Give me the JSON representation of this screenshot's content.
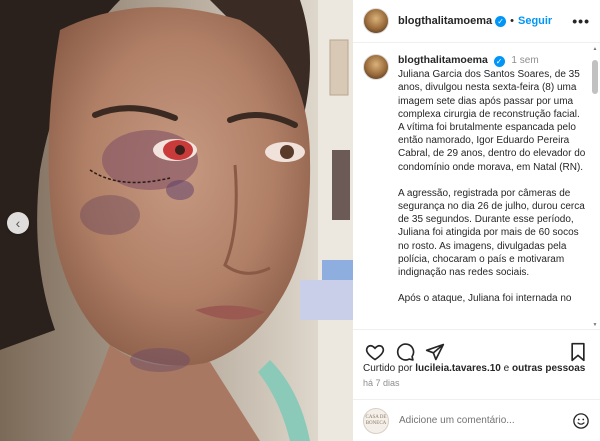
{
  "post": {
    "username": "blogthalitamoema",
    "follow_label": "Seguir",
    "more_label": "•••",
    "caption_time": "1 sem",
    "caption_paragraphs": [
      "Juliana Garcia dos Santos Soares, de 35 anos, divulgou nesta sexta-feira (8) uma imagem sete dias após passar por uma complexa cirurgia de reconstrução facial. A vítima foi brutalmente espancada pelo então namorado, Igor Eduardo Pereira Cabral, de 29 anos, dentro do elevador do condomínio onde morava, em Natal (RN).",
      "A agressão, registrada por câmeras de segurança no dia 26 de julho, durou cerca de 35 segundos. Durante esse período, Juliana foi atingida por mais de 60 socos no rosto. As imagens, divulgadas pela polícia, chocaram o país e motivaram indignação nas redes sociais.",
      "Após o ataque, Juliana foi internada no"
    ],
    "liked_by_prefix": "Curtido por ",
    "liked_by_user": "lucileia.tavares.10",
    "liked_by_middle": " e ",
    "liked_by_others": "outras pessoas",
    "posted_ago": "há 7 dias",
    "comment_placeholder": "Adicione um comentário...",
    "commenter_avatar_text": "CASA DE BONECA"
  },
  "icons": {
    "verified": "verified-badge-icon",
    "like": "heart-icon",
    "comment": "comment-bubble-icon",
    "share": "paper-plane-icon",
    "save": "bookmark-icon",
    "emoji": "smiley-icon",
    "carousel_prev": "chevron-left-icon"
  },
  "colors": {
    "accent": "#0095f6",
    "text": "#262626",
    "muted": "#8e8e8e"
  }
}
